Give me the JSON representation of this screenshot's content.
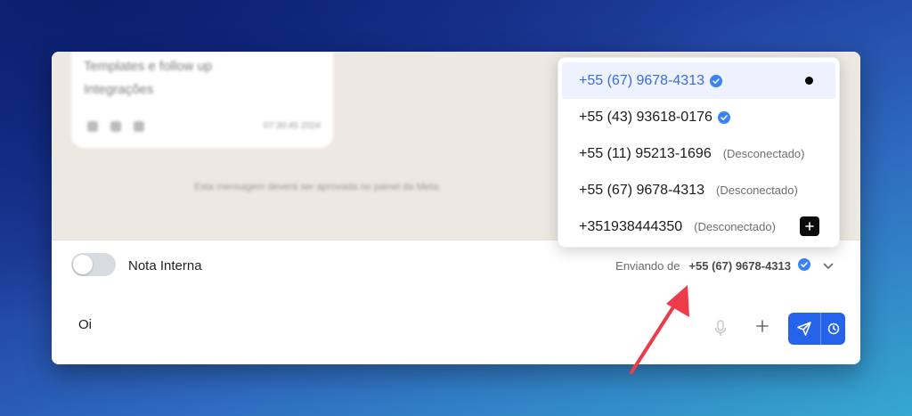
{
  "chat": {
    "blur_line_1": "Templates e follow up",
    "blur_line_2": "Integrações",
    "blur_time": "07:30:45 2024",
    "blur_system": "Esta mensagem deverá ser aprovada no painel da Meta."
  },
  "toolbar": {
    "nota_interna_label": "Nota Interna",
    "sending_label": "Enviando de",
    "sending_number": "+55 (67) 9678-4313"
  },
  "composer": {
    "message_value": "Oi"
  },
  "dropdown": {
    "options": [
      {
        "number": "+55 (67) 9678-4313",
        "status": "",
        "verified": true,
        "selected": true
      },
      {
        "number": "+55 (43) 93618-0176",
        "status": "",
        "verified": true,
        "selected": false
      },
      {
        "number": "+55 (11) 95213-1696",
        "status": "(Desconectado)",
        "verified": false,
        "selected": false
      },
      {
        "number": "+55 (67) 9678-4313",
        "status": "(Desconectado)",
        "verified": false,
        "selected": false
      },
      {
        "number": "+351938444350",
        "status": "(Desconectado)",
        "verified": false,
        "selected": false
      }
    ]
  },
  "colors": {
    "accent": "#2563eb",
    "verified": "#3b82f6",
    "selected_bg": "#edf2fe",
    "annotation_arrow": "#ee3b4a"
  }
}
